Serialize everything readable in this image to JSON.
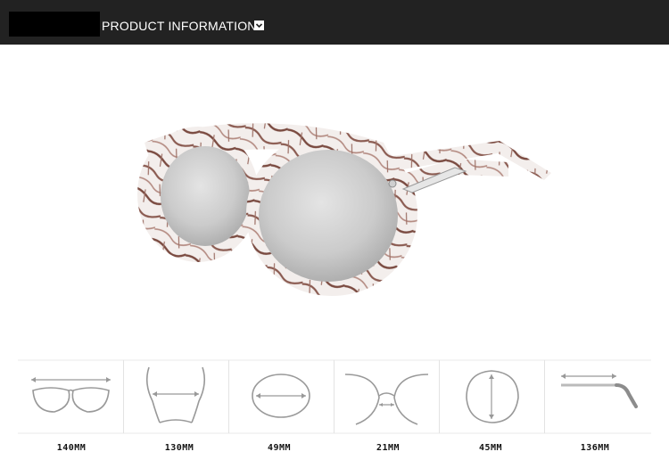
{
  "header": {
    "title": "PRODUCT INFORMATION",
    "background_color": "#222222",
    "title_color": "#ffffff",
    "toggle_icon": "chevron-down-icon"
  },
  "product": {
    "image_subject": "sunglasses",
    "frame_pattern": "marble",
    "frame_colors": [
      "#f2ecea",
      "#a87a6e",
      "#7a4a40"
    ],
    "lens_color": "#c9c9c9",
    "temple_accent": "#d9d9d9"
  },
  "specs": [
    {
      "id": "frame-width",
      "icon": "frame-width-icon",
      "value": "140MM"
    },
    {
      "id": "frame-height",
      "icon": "frame-height-icon",
      "value": "130MM"
    },
    {
      "id": "lens-width",
      "icon": "lens-width-icon",
      "value": "49MM"
    },
    {
      "id": "bridge-width",
      "icon": "bridge-width-icon",
      "value": "21MM"
    },
    {
      "id": "lens-height",
      "icon": "lens-height-icon",
      "value": "45MM"
    },
    {
      "id": "temple-length",
      "icon": "temple-length-icon",
      "value": "136MM"
    }
  ]
}
